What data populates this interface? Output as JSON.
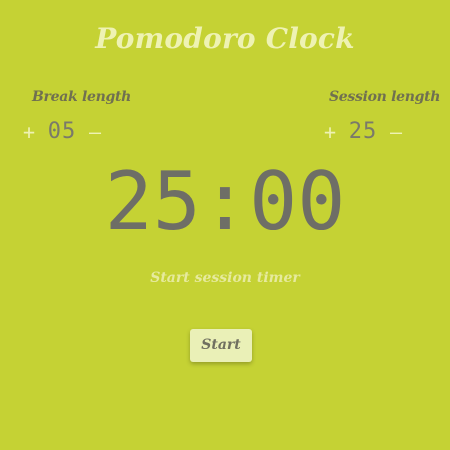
{
  "app": {
    "title": "Pomodoro Clock"
  },
  "break": {
    "label": "Break length",
    "value": "05",
    "increment_symbol": "+",
    "decrement_symbol": "–"
  },
  "session": {
    "label": "Session length",
    "value": "25",
    "increment_symbol": "+",
    "decrement_symbol": "–"
  },
  "timer": {
    "display": "25:00"
  },
  "status": {
    "text": "Start session timer"
  },
  "controls": {
    "start_label": "Start"
  },
  "colors": {
    "background": "#c5d234",
    "title": "#eef2b3",
    "digits": "#6e6e66",
    "button_bg": "#eaf0b7"
  }
}
